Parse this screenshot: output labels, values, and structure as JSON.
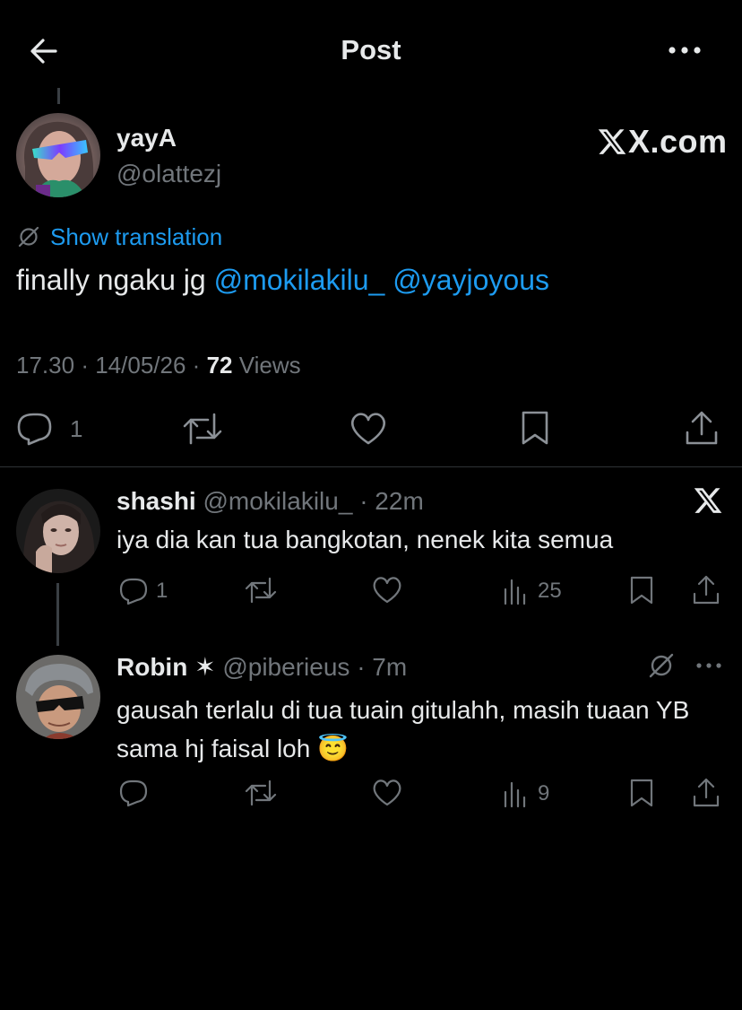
{
  "header": {
    "title": "Post"
  },
  "post": {
    "display_name": "yayA",
    "handle": "@olattezj",
    "watermark": "X.com",
    "show_translation": "Show translation",
    "text_prefix": "finally ngaku jg ",
    "mention_1": "@mokilakilu_",
    "mention_2": "@yayjoyous",
    "time": "17.30",
    "date": "14/05/26",
    "separator": "·",
    "views_count": "72",
    "views_label": "Views",
    "reply_count": "1"
  },
  "replies": [
    {
      "display_name": "shashi",
      "handle": "@mokilakilu_",
      "age": "22m",
      "text": "iya dia kan tua bangkotan, nenek kita semua",
      "reply_count": "1",
      "views": "25"
    },
    {
      "display_name": "Robin",
      "badge": "✶",
      "handle": "@piberieus",
      "age": "7m",
      "text": "gausah terlalu di tua tuain gitulahh, masih tuaan YB sama hj faisal loh",
      "emoji": "😇",
      "views": "9"
    }
  ],
  "icons": {
    "back": "arrow-left-icon",
    "more": "more-icon",
    "translate": "translate-icon",
    "reply": "reply-icon",
    "repost": "repost-icon",
    "like": "like-icon",
    "views": "views-icon",
    "bookmark": "bookmark-icon",
    "share": "share-icon",
    "x_logo": "x-logo-icon"
  },
  "colors": {
    "background": "#000000",
    "text": "#e7e9ea",
    "muted": "#71767b",
    "link": "#1d9bf0",
    "divider": "#2f3336"
  }
}
